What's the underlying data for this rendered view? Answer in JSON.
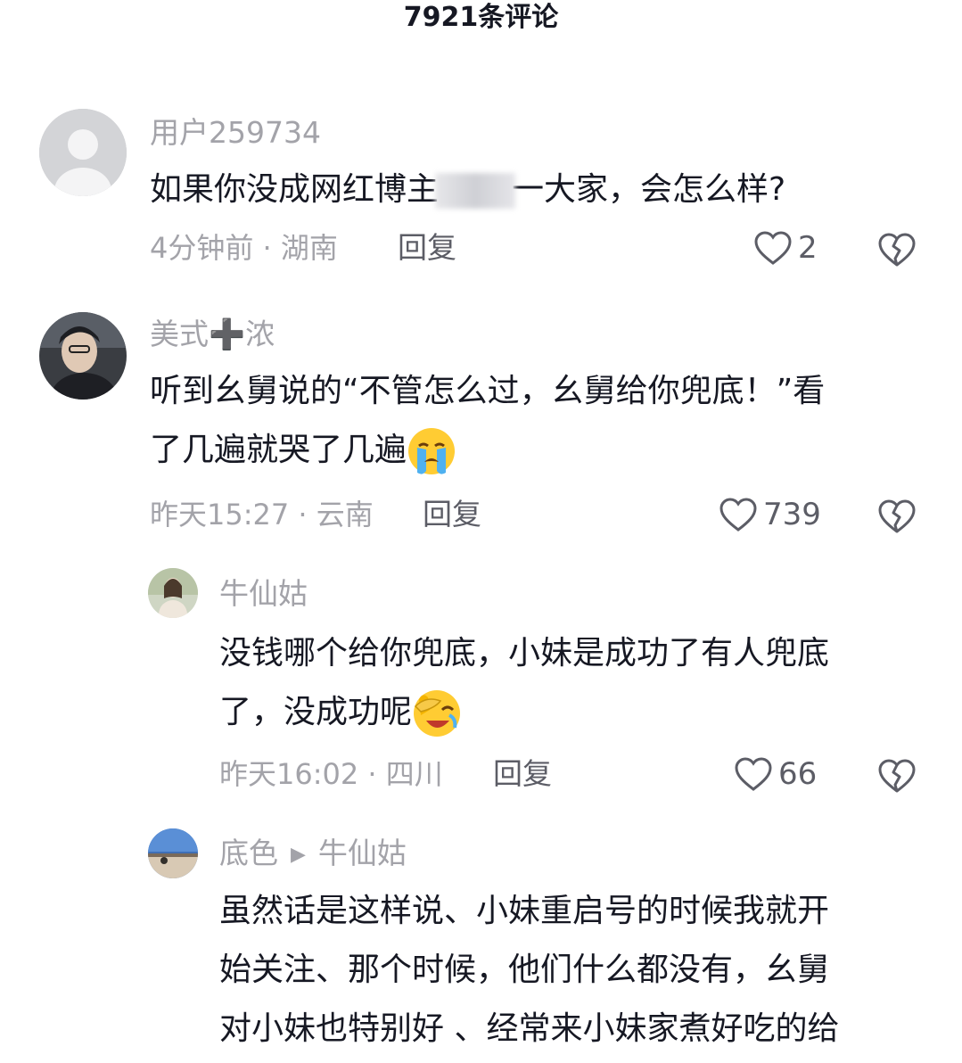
{
  "header": {
    "title": "7921条评论"
  },
  "comments": [
    {
      "username": "用户259734",
      "text_before": "如果你没成网红博主",
      "text_after": "一大家，会怎么样?",
      "meta": "4分钟前 · 湖南",
      "reply_label": "回复",
      "likes": "2"
    },
    {
      "username": "美式➕浓",
      "text_line1": "听到幺舅说的“不管怎么过，幺舅给你兜底！”看",
      "text_line2": "了几遍就哭了几遍",
      "meta": "昨天15:27 · 云南",
      "reply_label": "回复",
      "likes": "739"
    },
    {
      "username": "牛仙姑",
      "text_line1": "没钱哪个给你兜底，小妹是成功了有人兜底",
      "text_line2": "了，没成功呢",
      "meta": "昨天16:02 · 四川",
      "reply_label": "回复",
      "likes": "66"
    },
    {
      "username": "底色",
      "reply_to": "牛仙姑",
      "text_line1": "虽然话是这样说、小妹重启号的时候我就开",
      "text_line2": "始关注、那个时候，他们什么都没有，幺舅",
      "text_line3": "对小妹也特别好 、经常来小妹家煮好吃的给"
    }
  ],
  "colors": {
    "text": "#161823",
    "secondary": "#a3a3a9",
    "action": "#5c5d66"
  },
  "icons": [
    "heart-icon",
    "broken-heart-icon",
    "crying-emoji",
    "facepalm-laugh-emoji",
    "triangle-arrow-icon"
  ]
}
